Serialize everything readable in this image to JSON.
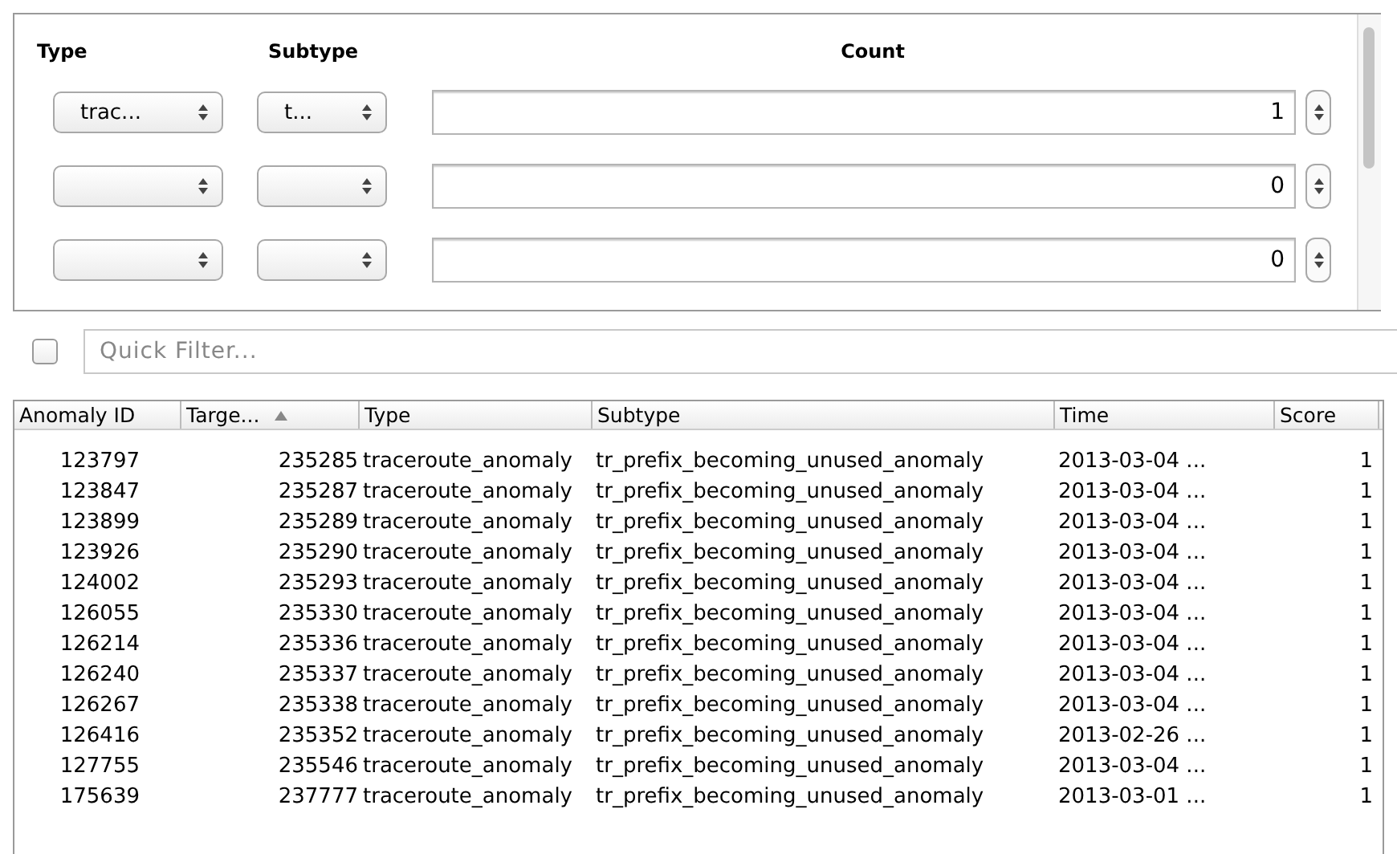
{
  "rule_panel": {
    "headers": [
      "Type",
      "Subtype",
      "Count"
    ],
    "rows": [
      {
        "type": "trac...",
        "subtype": "t...",
        "count": "1"
      },
      {
        "type": "",
        "subtype": "",
        "count": "0"
      },
      {
        "type": "",
        "subtype": "",
        "count": "0"
      }
    ]
  },
  "quick_filter": {
    "checked": false,
    "placeholder": "Quick Filter..."
  },
  "table": {
    "columns": [
      {
        "label": "Anomaly ID",
        "sorted": false
      },
      {
        "label": "Targe...",
        "sorted": true
      },
      {
        "label": "Type",
        "sorted": false
      },
      {
        "label": "Subtype",
        "sorted": false
      },
      {
        "label": "Time",
        "sorted": false
      },
      {
        "label": "Score",
        "sorted": false
      }
    ],
    "rows": [
      [
        "123797",
        "235285",
        "traceroute_anomaly",
        "tr_prefix_becoming_unused_anomaly",
        "2013-03-04 ...",
        "1"
      ],
      [
        "123847",
        "235287",
        "traceroute_anomaly",
        "tr_prefix_becoming_unused_anomaly",
        "2013-03-04 ...",
        "1"
      ],
      [
        "123899",
        "235289",
        "traceroute_anomaly",
        "tr_prefix_becoming_unused_anomaly",
        "2013-03-04 ...",
        "1"
      ],
      [
        "123926",
        "235290",
        "traceroute_anomaly",
        "tr_prefix_becoming_unused_anomaly",
        "2013-03-04 ...",
        "1"
      ],
      [
        "124002",
        "235293",
        "traceroute_anomaly",
        "tr_prefix_becoming_unused_anomaly",
        "2013-03-04 ...",
        "1"
      ],
      [
        "126055",
        "235330",
        "traceroute_anomaly",
        "tr_prefix_becoming_unused_anomaly",
        "2013-03-04 ...",
        "1"
      ],
      [
        "126214",
        "235336",
        "traceroute_anomaly",
        "tr_prefix_becoming_unused_anomaly",
        "2013-03-04 ...",
        "1"
      ],
      [
        "126240",
        "235337",
        "traceroute_anomaly",
        "tr_prefix_becoming_unused_anomaly",
        "2013-03-04 ...",
        "1"
      ],
      [
        "126267",
        "235338",
        "traceroute_anomaly",
        "tr_prefix_becoming_unused_anomaly",
        "2013-03-04 ...",
        "1"
      ],
      [
        "126416",
        "235352",
        "traceroute_anomaly",
        "tr_prefix_becoming_unused_anomaly",
        "2013-02-26 ...",
        "1"
      ],
      [
        "127755",
        "235546",
        "traceroute_anomaly",
        "tr_prefix_becoming_unused_anomaly",
        "2013-03-04 ...",
        "1"
      ],
      [
        "175639",
        "237777",
        "traceroute_anomaly",
        "tr_prefix_becoming_unused_anomaly",
        "2013-03-01 ...",
        "1"
      ]
    ]
  }
}
